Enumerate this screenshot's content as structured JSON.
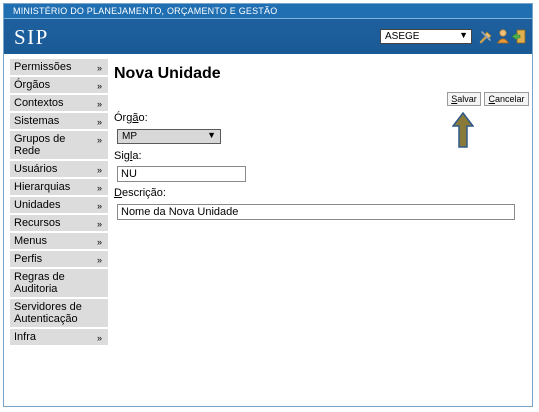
{
  "header": {
    "ministry": "MINISTÉRIO DO PLANEJAMENTO, ORÇAMENTO E GESTÃO",
    "logo": "SIP",
    "unit_selector": {
      "value": "ASEGE"
    },
    "icons": [
      "tools-icon",
      "user-icon",
      "exit-icon"
    ]
  },
  "sidebar": {
    "items": [
      {
        "label": "Permissões",
        "has_arrow": true
      },
      {
        "label": "Órgãos",
        "has_arrow": true
      },
      {
        "label": "Contextos",
        "has_arrow": true
      },
      {
        "label": "Sistemas",
        "has_arrow": true
      },
      {
        "label": "Grupos de Rede",
        "has_arrow": true
      },
      {
        "label": "Usuários",
        "has_arrow": true
      },
      {
        "label": "Hierarquias",
        "has_arrow": true
      },
      {
        "label": "Unidades",
        "has_arrow": true
      },
      {
        "label": "Recursos",
        "has_arrow": true
      },
      {
        "label": "Menus",
        "has_arrow": true
      },
      {
        "label": "Perfis",
        "has_arrow": true
      },
      {
        "label": "Regras de Auditoria",
        "has_arrow": false
      },
      {
        "label": "Servidores de Autenticação",
        "has_arrow": false
      },
      {
        "label": "Infra",
        "has_arrow": true
      }
    ],
    "arrow_glyph": "»"
  },
  "main": {
    "title": "Nova Unidade",
    "buttons": {
      "save": {
        "first": "S",
        "rest": "alvar"
      },
      "cancel": {
        "first": "C",
        "rest": "ancelar"
      }
    },
    "orgao": {
      "label_first": "Órg",
      "label_accel": "ã",
      "label_rest": "o:",
      "value": "MP"
    },
    "sigla": {
      "label_first": "Sig",
      "label_accel": "l",
      "label_rest": "a:",
      "value": "NU"
    },
    "descricao": {
      "label_accel": "D",
      "label_rest": "escrição:",
      "value": "Nome da Nova Unidade"
    }
  },
  "colors": {
    "topbar": "#1f6fb2",
    "header": "#1e5f9e",
    "sidebar_item": "#dcdcdc",
    "arrow_fill": "#8a7a3a",
    "arrow_stroke": "#2e5a8a"
  }
}
